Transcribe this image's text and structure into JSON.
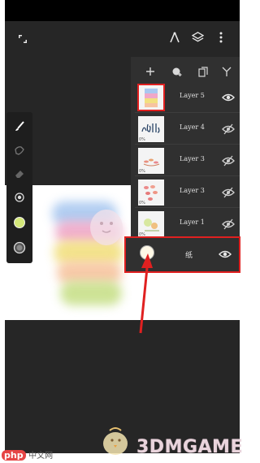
{
  "top_bar": {
    "icons": [
      "expand-icon",
      "ruler-icon",
      "layers-icon",
      "more-vert-icon"
    ]
  },
  "tools": [
    "brush-icon",
    "smudge-icon",
    "eraser-icon",
    "brush-size-icon",
    "color-swatch-icon",
    "opacity-icon"
  ],
  "colors": {
    "active_color": "#d4e87a",
    "highlight": "#e02020",
    "panel": "#303030",
    "app_bg": "#262626"
  },
  "layers_panel": {
    "toolbar_icons": [
      "add-layer-icon",
      "add-group-icon",
      "duplicate-icon",
      "merge-icon"
    ],
    "layers": [
      {
        "name": "Layer 5",
        "visible": true,
        "selected": true,
        "thumb_pct": ""
      },
      {
        "name": "Layer 4",
        "visible": false,
        "selected": false,
        "thumb_pct": "0%"
      },
      {
        "name": "Layer 3",
        "visible": false,
        "selected": false,
        "thumb_pct": "0%"
      },
      {
        "name": "Layer 3",
        "visible": false,
        "selected": false,
        "thumb_pct": "0%"
      },
      {
        "name": "Layer 1",
        "visible": false,
        "selected": false,
        "thumb_pct": "0%"
      }
    ],
    "background": {
      "label": "纸",
      "visible": true
    }
  },
  "watermark": {
    "brand": "3DMGAME",
    "php_badge": "php",
    "php_cn": "中文网"
  }
}
